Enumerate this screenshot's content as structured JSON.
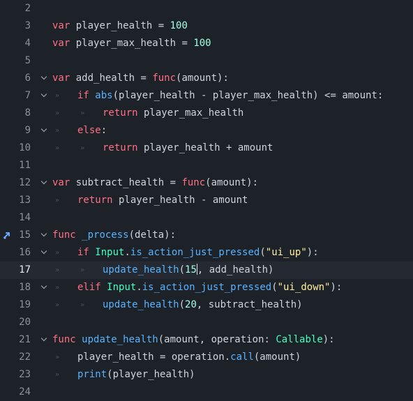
{
  "editor": {
    "colors": {
      "background": "#1d2128",
      "current_line": "#252a32",
      "keyword": "#ff7085",
      "function": "#57b3ff",
      "number": "#a1ffe0",
      "string": "#ffeda1",
      "type": "#42ffc2",
      "text": "#ced4da",
      "line_number": "#8b919a"
    },
    "current_line_number": "17",
    "breakpoint_icon": "debug-arrow-icon",
    "lines": [
      {
        "n": "2",
        "indent": 0,
        "fold": false,
        "tokens": []
      },
      {
        "n": "3",
        "indent": 0,
        "fold": false,
        "tokens": [
          [
            "kw",
            "var"
          ],
          [
            "id",
            " player_health = "
          ],
          [
            "num",
            "100"
          ]
        ]
      },
      {
        "n": "4",
        "indent": 0,
        "fold": false,
        "tokens": [
          [
            "kw",
            "var"
          ],
          [
            "id",
            " player_max_health = "
          ],
          [
            "num",
            "100"
          ]
        ]
      },
      {
        "n": "5",
        "indent": 0,
        "fold": false,
        "tokens": []
      },
      {
        "n": "6",
        "indent": 0,
        "fold": true,
        "tokens": [
          [
            "kw",
            "var"
          ],
          [
            "id",
            " add_health = "
          ],
          [
            "kw",
            "func"
          ],
          [
            "id",
            "(amount):"
          ]
        ]
      },
      {
        "n": "7",
        "indent": 1,
        "fold": true,
        "tokens": [
          [
            "kw",
            "if "
          ],
          [
            "fn",
            "abs"
          ],
          [
            "id",
            "(player_health - player_max_health) <= amount:"
          ]
        ]
      },
      {
        "n": "8",
        "indent": 2,
        "fold": false,
        "tokens": [
          [
            "kw",
            "return"
          ],
          [
            "id",
            " player_max_health"
          ]
        ]
      },
      {
        "n": "9",
        "indent": 1,
        "fold": true,
        "tokens": [
          [
            "kw",
            "else"
          ],
          [
            "id",
            ":"
          ]
        ]
      },
      {
        "n": "10",
        "indent": 2,
        "fold": false,
        "tokens": [
          [
            "kw",
            "return"
          ],
          [
            "id",
            " player_health + amount"
          ]
        ]
      },
      {
        "n": "11",
        "indent": 0,
        "fold": false,
        "tokens": []
      },
      {
        "n": "12",
        "indent": 0,
        "fold": true,
        "tokens": [
          [
            "kw",
            "var"
          ],
          [
            "id",
            " subtract_health = "
          ],
          [
            "kw",
            "func"
          ],
          [
            "id",
            "(amount):"
          ]
        ]
      },
      {
        "n": "13",
        "indent": 1,
        "fold": false,
        "tokens": [
          [
            "kw",
            "return"
          ],
          [
            "id",
            " player_health - amount"
          ]
        ]
      },
      {
        "n": "14",
        "indent": 0,
        "fold": false,
        "tokens": []
      },
      {
        "n": "15",
        "indent": 0,
        "fold": true,
        "marker": true,
        "tokens": [
          [
            "kw",
            "func"
          ],
          [
            "id",
            " "
          ],
          [
            "fn",
            "_process"
          ],
          [
            "id",
            "(delta):"
          ]
        ]
      },
      {
        "n": "16",
        "indent": 1,
        "fold": true,
        "tokens": [
          [
            "kw",
            "if "
          ],
          [
            "ty",
            "Input"
          ],
          [
            "id",
            "."
          ],
          [
            "fn",
            "is_action_just_pressed"
          ],
          [
            "id",
            "("
          ],
          [
            "str",
            "\"ui_up\""
          ],
          [
            "id",
            "):"
          ]
        ]
      },
      {
        "n": "17",
        "indent": 2,
        "fold": false,
        "current": true,
        "tokens": [
          [
            "fn",
            "update_health"
          ],
          [
            "id",
            "("
          ],
          [
            "num",
            "15"
          ],
          [
            "caret",
            ""
          ],
          [
            "id",
            ", add_health)"
          ]
        ]
      },
      {
        "n": "18",
        "indent": 1,
        "fold": true,
        "tokens": [
          [
            "kw",
            "elif "
          ],
          [
            "ty",
            "Input"
          ],
          [
            "id",
            "."
          ],
          [
            "fn",
            "is_action_just_pressed"
          ],
          [
            "id",
            "("
          ],
          [
            "str",
            "\"ui_down\""
          ],
          [
            "id",
            "):"
          ]
        ]
      },
      {
        "n": "19",
        "indent": 2,
        "fold": false,
        "tokens": [
          [
            "fn",
            "update_health"
          ],
          [
            "id",
            "("
          ],
          [
            "num",
            "20"
          ],
          [
            "id",
            ", subtract_health)"
          ]
        ]
      },
      {
        "n": "20",
        "indent": 0,
        "fold": false,
        "tokens": []
      },
      {
        "n": "21",
        "indent": 0,
        "fold": true,
        "tokens": [
          [
            "kw",
            "func"
          ],
          [
            "id",
            " "
          ],
          [
            "fn",
            "update_health"
          ],
          [
            "id",
            "(amount, operation: "
          ],
          [
            "ty",
            "Callable"
          ],
          [
            "id",
            "):"
          ]
        ]
      },
      {
        "n": "22",
        "indent": 1,
        "fold": false,
        "tokens": [
          [
            "id",
            "player_health = operation."
          ],
          [
            "fn",
            "call"
          ],
          [
            "id",
            "(amount)"
          ]
        ]
      },
      {
        "n": "23",
        "indent": 1,
        "fold": false,
        "tokens": [
          [
            "fn",
            "print"
          ],
          [
            "id",
            "(player_health)"
          ]
        ]
      },
      {
        "n": "24",
        "indent": 0,
        "fold": false,
        "tokens": []
      }
    ]
  }
}
